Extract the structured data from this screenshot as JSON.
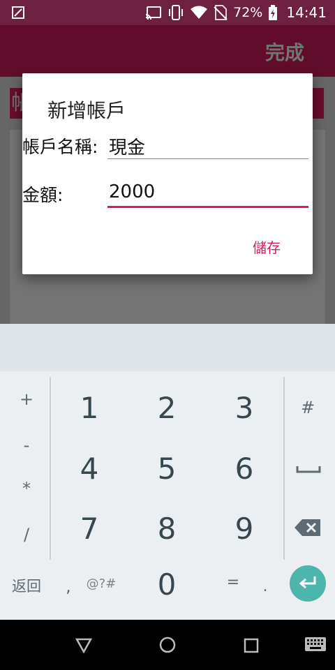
{
  "status_bar": {
    "battery": "72%",
    "time": "14:41",
    "left_icon": "screenshot-edit-icon",
    "icons": [
      "cast-icon",
      "vibrate-icon",
      "wifi-icon",
      "no-sim-icon",
      "battery-icon"
    ]
  },
  "app": {
    "toolbar_action": "完成",
    "strip_text": "帳"
  },
  "dialog": {
    "title": "新增帳戶",
    "account_label": "帳戶名稱:",
    "account_value": "現金",
    "amount_label": "金額:",
    "amount_value": "2000",
    "save_label": "儲存"
  },
  "keyboard": {
    "left_keys": [
      "+",
      "-",
      "*",
      "/"
    ],
    "digits": [
      "1",
      "2",
      "3",
      "4",
      "5",
      "6",
      "7",
      "8",
      "9",
      "0"
    ],
    "right_keys": [
      "#"
    ],
    "bottom": {
      "back": "返回",
      "comma": ",",
      "symbols": "@?#",
      "equals": "=",
      "period": "."
    },
    "icons": [
      "space-icon",
      "backspace-icon",
      "enter-icon"
    ]
  },
  "nav_bar": {
    "icons": [
      "back-triangle-icon",
      "home-circle-icon",
      "recents-square-icon",
      "keyboard-switch-icon"
    ]
  },
  "colors": {
    "status_bar": "#6d2040",
    "accent": "#d81b60",
    "enter_key": "#4db6ac"
  }
}
